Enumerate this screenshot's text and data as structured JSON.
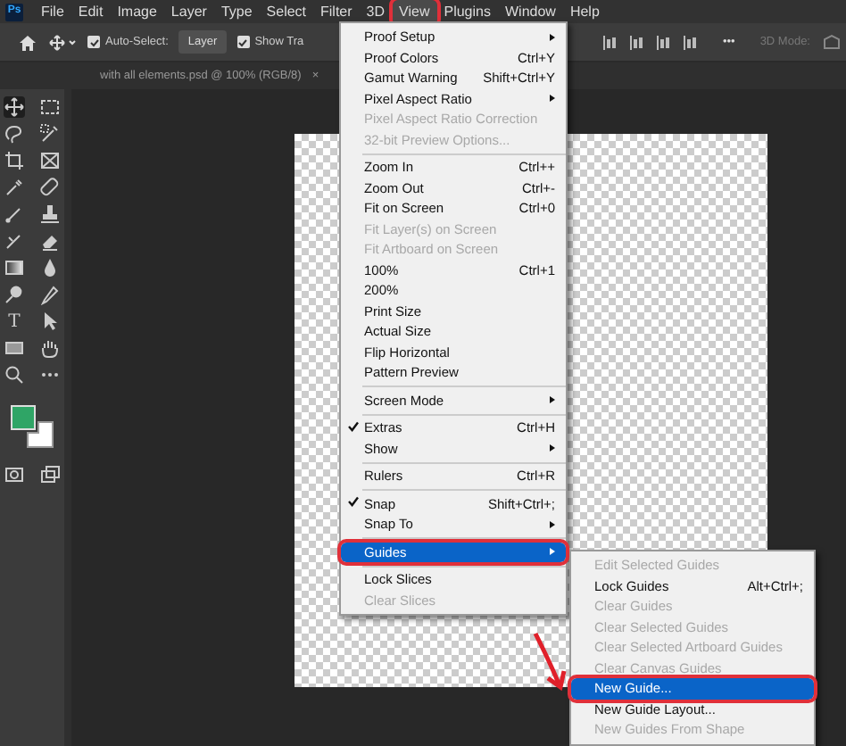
{
  "app_logo": "Ps",
  "menubar": [
    {
      "label": "File",
      "selected": false
    },
    {
      "label": "Edit",
      "selected": false
    },
    {
      "label": "Image",
      "selected": false
    },
    {
      "label": "Layer",
      "selected": false
    },
    {
      "label": "Type",
      "selected": false
    },
    {
      "label": "Select",
      "selected": false
    },
    {
      "label": "Filter",
      "selected": false
    },
    {
      "label": "3D",
      "selected": false
    },
    {
      "label": "View",
      "selected": true,
      "annotated": true
    },
    {
      "label": "Plugins",
      "selected": false
    },
    {
      "label": "Window",
      "selected": false
    },
    {
      "label": "Help",
      "selected": false
    }
  ],
  "options_bar": {
    "auto_select": {
      "label": "Auto-Select:",
      "checked": true
    },
    "target_dropdown": "Layer",
    "show_transform": {
      "label": "Show Tra",
      "checked": true
    },
    "more": "•••",
    "mode_label": "3D Mode:"
  },
  "document_tab": {
    "title": "with all elements.psd @ 100% (RGB/8)",
    "close": "×"
  },
  "toolbar": {
    "type_tool": "T",
    "swatches": [
      {
        "kind": "foreground",
        "color": "#2fa566"
      },
      {
        "kind": "background",
        "color": "#ffffff"
      }
    ]
  },
  "view_menu": [
    {
      "kind": "item",
      "label": "Proof Setup",
      "submenu": true,
      "checked": false,
      "disabled": false,
      "selected": false
    },
    {
      "kind": "item",
      "label": "Proof Colors",
      "shortcut": "Ctrl+Y",
      "submenu": false,
      "checked": false,
      "disabled": false,
      "selected": false
    },
    {
      "kind": "item",
      "label": "Gamut Warning",
      "shortcut": "Shift+Ctrl+Y",
      "submenu": false,
      "checked": false,
      "disabled": false,
      "selected": false
    },
    {
      "kind": "item",
      "label": "Pixel Aspect Ratio",
      "submenu": true,
      "checked": false,
      "disabled": false,
      "selected": false
    },
    {
      "kind": "item",
      "label": "Pixel Aspect Ratio Correction",
      "submenu": false,
      "checked": false,
      "disabled": true,
      "selected": false
    },
    {
      "kind": "item",
      "label": "32-bit Preview Options...",
      "submenu": false,
      "checked": false,
      "disabled": true,
      "selected": false
    },
    {
      "kind": "separator"
    },
    {
      "kind": "item",
      "label": "Zoom In",
      "shortcut": "Ctrl++",
      "submenu": false,
      "checked": false,
      "disabled": false,
      "selected": false
    },
    {
      "kind": "item",
      "label": "Zoom Out",
      "shortcut": "Ctrl+-",
      "submenu": false,
      "checked": false,
      "disabled": false,
      "selected": false
    },
    {
      "kind": "item",
      "label": "Fit on Screen",
      "shortcut": "Ctrl+0",
      "submenu": false,
      "checked": false,
      "disabled": false,
      "selected": false
    },
    {
      "kind": "item",
      "label": "Fit Layer(s) on Screen",
      "submenu": false,
      "checked": false,
      "disabled": true,
      "selected": false
    },
    {
      "kind": "item",
      "label": "Fit Artboard on Screen",
      "submenu": false,
      "checked": false,
      "disabled": true,
      "selected": false
    },
    {
      "kind": "item",
      "label": "100%",
      "shortcut": "Ctrl+1",
      "submenu": false,
      "checked": false,
      "disabled": false,
      "selected": false
    },
    {
      "kind": "item",
      "label": "200%",
      "submenu": false,
      "checked": false,
      "disabled": false,
      "selected": false
    },
    {
      "kind": "item",
      "label": "Print Size",
      "submenu": false,
      "checked": false,
      "disabled": false,
      "selected": false
    },
    {
      "kind": "item",
      "label": "Actual Size",
      "submenu": false,
      "checked": false,
      "disabled": false,
      "selected": false
    },
    {
      "kind": "item",
      "label": "Flip Horizontal",
      "submenu": false,
      "checked": false,
      "disabled": false,
      "selected": false
    },
    {
      "kind": "item",
      "label": "Pattern Preview",
      "submenu": false,
      "checked": false,
      "disabled": false,
      "selected": false
    },
    {
      "kind": "separator"
    },
    {
      "kind": "item",
      "label": "Screen Mode",
      "submenu": true,
      "checked": false,
      "disabled": false,
      "selected": false
    },
    {
      "kind": "separator"
    },
    {
      "kind": "item",
      "label": "Extras",
      "shortcut": "Ctrl+H",
      "submenu": false,
      "checked": true,
      "disabled": false,
      "selected": false
    },
    {
      "kind": "item",
      "label": "Show",
      "submenu": true,
      "checked": false,
      "disabled": false,
      "selected": false
    },
    {
      "kind": "separator"
    },
    {
      "kind": "item",
      "label": "Rulers",
      "shortcut": "Ctrl+R",
      "submenu": false,
      "checked": false,
      "disabled": false,
      "selected": false
    },
    {
      "kind": "separator"
    },
    {
      "kind": "item",
      "label": "Snap",
      "shortcut": "Shift+Ctrl+;",
      "submenu": false,
      "checked": true,
      "disabled": false,
      "selected": false
    },
    {
      "kind": "item",
      "label": "Snap To",
      "submenu": true,
      "checked": false,
      "disabled": false,
      "selected": false
    },
    {
      "kind": "separator"
    },
    {
      "kind": "item",
      "label": "Guides",
      "submenu": true,
      "checked": false,
      "disabled": false,
      "selected": true,
      "annotated": true
    },
    {
      "kind": "separator"
    },
    {
      "kind": "item",
      "label": "Lock Slices",
      "submenu": false,
      "checked": false,
      "disabled": false,
      "selected": false
    },
    {
      "kind": "item",
      "label": "Clear Slices",
      "submenu": false,
      "checked": false,
      "disabled": true,
      "selected": false
    }
  ],
  "guides_submenu": [
    {
      "kind": "item",
      "label": "Edit Selected Guides",
      "disabled": true,
      "selected": false
    },
    {
      "kind": "item",
      "label": "Lock Guides",
      "shortcut": "Alt+Ctrl+;",
      "disabled": false,
      "selected": false
    },
    {
      "kind": "item",
      "label": "Clear Guides",
      "disabled": true,
      "selected": false
    },
    {
      "kind": "item",
      "label": "Clear Selected Guides",
      "disabled": true,
      "selected": false
    },
    {
      "kind": "item",
      "label": "Clear Selected Artboard Guides",
      "disabled": true,
      "selected": false
    },
    {
      "kind": "item",
      "label": "Clear Canvas Guides",
      "disabled": true,
      "selected": false
    },
    {
      "kind": "item",
      "label": "New Guide...",
      "disabled": false,
      "selected": true,
      "annotated": true
    },
    {
      "kind": "item",
      "label": "New Guide Layout...",
      "disabled": false,
      "selected": false
    },
    {
      "kind": "item",
      "label": "New Guides From Shape",
      "disabled": true,
      "selected": false
    }
  ]
}
